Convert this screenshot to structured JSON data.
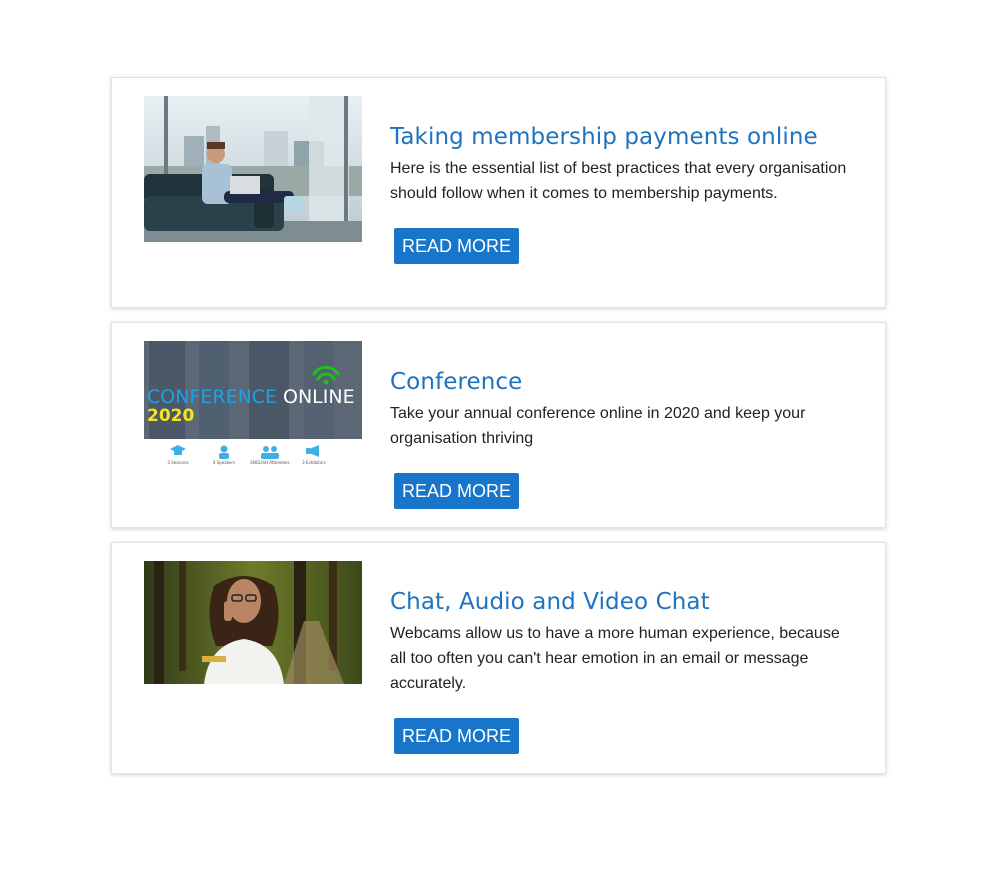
{
  "articles": [
    {
      "image_alt": "man sitting on sofa with laptop by window",
      "title": "Taking membership payments online",
      "description": "Here is the essential list of best practices that every organisation should follow when it comes to membership payments.",
      "button_label": "READ MORE"
    },
    {
      "image_alt": "conference online banner",
      "image_text": {
        "headline_left": "CONFERENCE",
        "headline_right": "ONLINE",
        "year": "2020",
        "stats": [
          "3 Sessions",
          "4 Speakers",
          "ENGLISH Attendees",
          "3 Exhibitors"
        ]
      },
      "title": "Conference",
      "description": "Take your annual conference online in 2020 and keep your organisation thriving",
      "button_label": "READ MORE"
    },
    {
      "image_alt": "woman with glasses talking on phone in park",
      "title": "Chat, Audio and Video Chat",
      "description": "Webcams allow us to have a more human experience, because all too often you can't hear emotion in an email or message accurately.",
      "button_label": "READ MORE"
    }
  ],
  "colors": {
    "title": "#1e72c0",
    "button": "#1776ca",
    "text": "#222222",
    "accent_yellow": "#f2e51d",
    "accent_blue": "#1fa0e3",
    "wifi_green": "#1ec21e"
  }
}
